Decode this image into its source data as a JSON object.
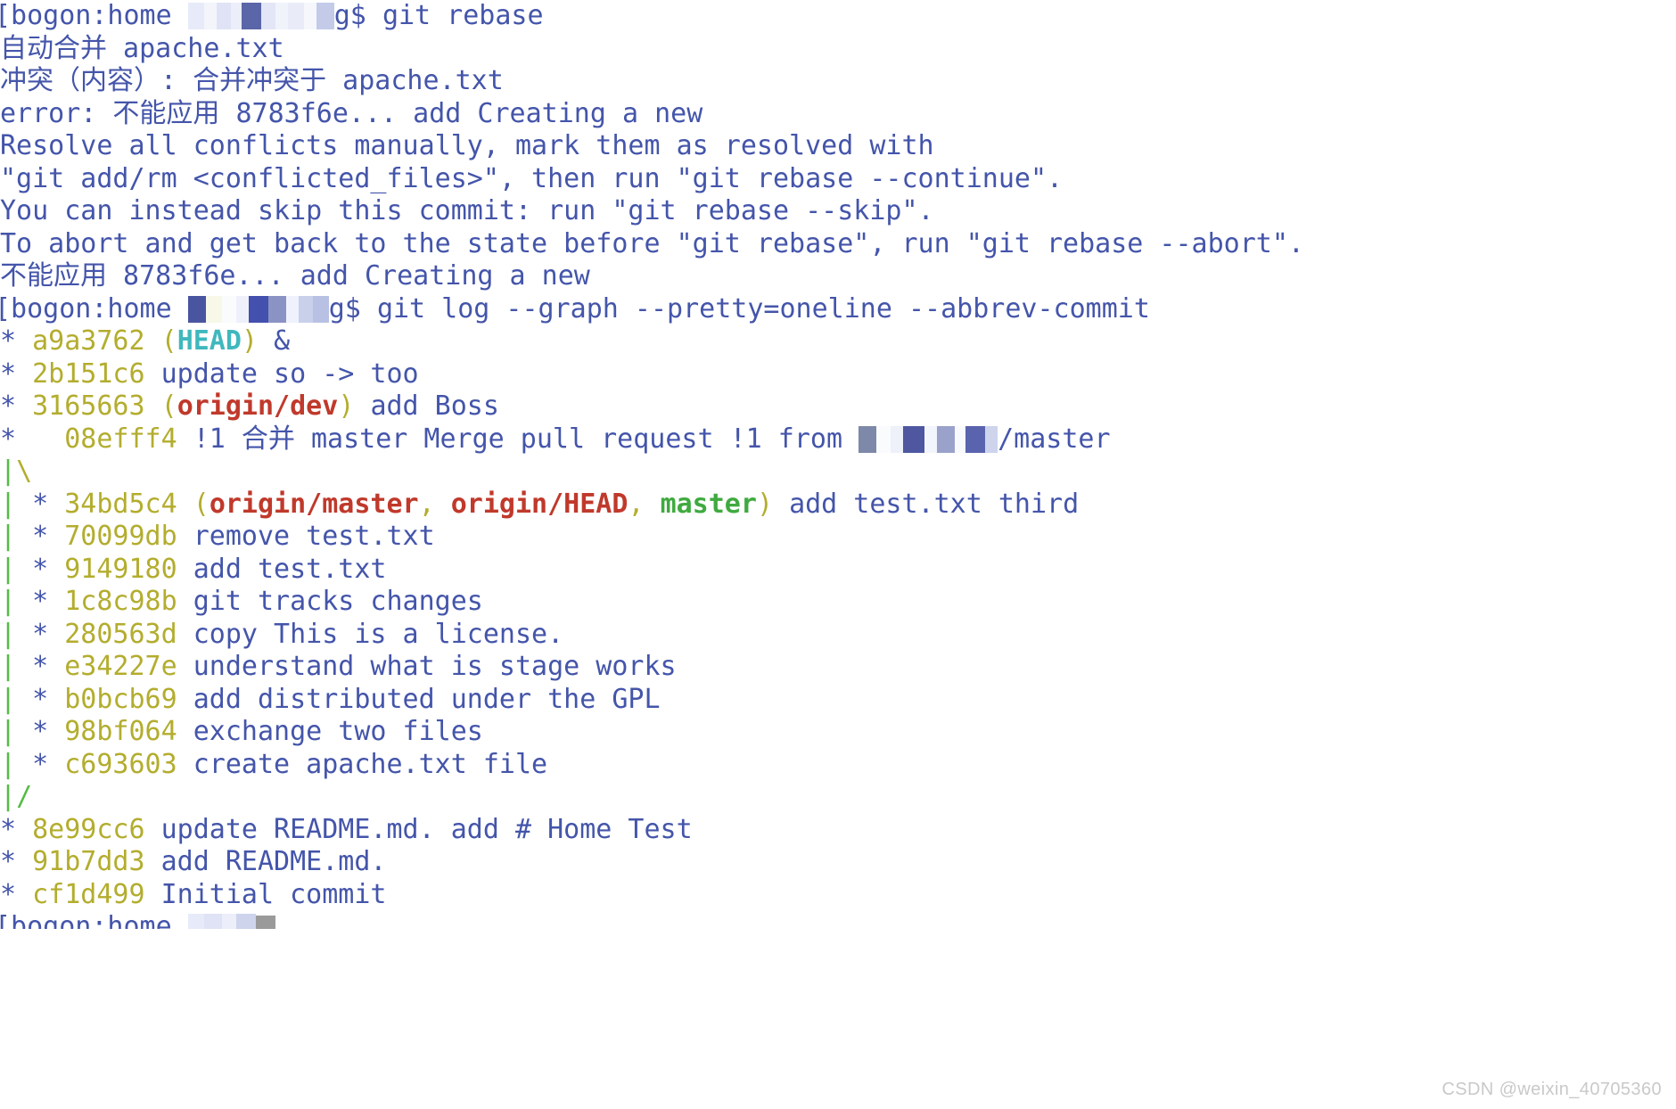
{
  "terminal": {
    "host_prompt": "[bogon:home ",
    "prompt_suffix": "g$ ",
    "colors": {
      "foreground": "#4455aa",
      "background": "#ffffff",
      "commit_hash": "#b3ad2e",
      "head_ref": "#3fb8bd",
      "remote_ref": "#c0392b",
      "local_ref": "#3faa3f",
      "graph_rail": "#55bb44",
      "graph_slash": "#b3ad2e",
      "cursor": "#9a9a9a",
      "watermark": "#c9c9c9"
    },
    "commands": {
      "rebase": "git rebase",
      "log": "git log --graph --pretty=oneline --abbrev-commit"
    },
    "rebase_output": [
      "自动合并 apache.txt",
      "冲突（内容）: 合并冲突于 apache.txt",
      "error: 不能应用 8783f6e... add Creating a new",
      "Resolve all conflicts manually, mark them as resolved with",
      "\"git add/rm <conflicted_files>\", then run \"git rebase --continue\".",
      "You can instead skip this commit: run \"git rebase --skip\".",
      "To abort and get back to the state before \"git rebase\", run \"git rebase --abort\".",
      "不能应用 8783f6e... add Creating a new"
    ],
    "log_entries": [
      {
        "rail": "",
        "star": "* ",
        "hash": "a9a3762",
        "refs_open": " (",
        "refs": [
          {
            "text": "HEAD",
            "kind": "head"
          }
        ],
        "refs_close": ") ",
        "subject": "&"
      },
      {
        "rail": "",
        "star": "* ",
        "hash": "2b151c6",
        "refs_open": " ",
        "refs": [],
        "refs_close": "",
        "subject": "update so -> too"
      },
      {
        "rail": "",
        "star": "* ",
        "hash": "3165663",
        "refs_open": " (",
        "refs": [
          {
            "text": "origin/dev",
            "kind": "remote"
          }
        ],
        "refs_close": ") ",
        "subject": "add Boss"
      },
      {
        "rail": "",
        "star": "*   ",
        "hash": "08efff4",
        "refs_open": " ",
        "refs": [],
        "refs_close": "",
        "subject": "!1 合并 master Merge pull request !1 from ",
        "redacted_tail": "/master"
      },
      {
        "rail": "graph-branch-open"
      },
      {
        "rail": "| ",
        "star": "* ",
        "hash": "34bd5c4",
        "refs_open": " (",
        "refs": [
          {
            "text": "origin/master",
            "kind": "remote"
          },
          {
            "text": "origin/HEAD",
            "kind": "remote"
          },
          {
            "text": "master",
            "kind": "local"
          }
        ],
        "refs_close": ") ",
        "subject": "add test.txt third"
      },
      {
        "rail": "| ",
        "star": "* ",
        "hash": "70099db",
        "refs_open": " ",
        "refs": [],
        "refs_close": "",
        "subject": "remove test.txt"
      },
      {
        "rail": "| ",
        "star": "* ",
        "hash": "9149180",
        "refs_open": " ",
        "refs": [],
        "refs_close": "",
        "subject": "add test.txt"
      },
      {
        "rail": "| ",
        "star": "* ",
        "hash": "1c8c98b",
        "refs_open": " ",
        "refs": [],
        "refs_close": "",
        "subject": "git tracks changes"
      },
      {
        "rail": "| ",
        "star": "* ",
        "hash": "280563d",
        "refs_open": " ",
        "refs": [],
        "refs_close": "",
        "subject": "copy This is a license."
      },
      {
        "rail": "| ",
        "star": "* ",
        "hash": "e34227e",
        "refs_open": " ",
        "refs": [],
        "refs_close": "",
        "subject": "understand what is stage works"
      },
      {
        "rail": "| ",
        "star": "* ",
        "hash": "b0bcb69",
        "refs_open": " ",
        "refs": [],
        "refs_close": "",
        "subject": "add distributed under the GPL"
      },
      {
        "rail": "| ",
        "star": "* ",
        "hash": "98bf064",
        "refs_open": " ",
        "refs": [],
        "refs_close": "",
        "subject": "exchange two files"
      },
      {
        "rail": "| ",
        "star": "* ",
        "hash": "c693603",
        "refs_open": " ",
        "refs": [],
        "refs_close": "",
        "subject": "create apache.txt file"
      },
      {
        "rail": "graph-branch-close"
      },
      {
        "rail": "",
        "star": "* ",
        "hash": "8e99cc6",
        "refs_open": " ",
        "refs": [],
        "refs_close": "",
        "subject": "update README.md. add # Home Test"
      },
      {
        "rail": "",
        "star": "* ",
        "hash": "91b7dd3",
        "refs_open": " ",
        "refs": [],
        "refs_close": "",
        "subject": "add README.md."
      },
      {
        "rail": "",
        "star": "* ",
        "hash": "cf1d499",
        "refs_open": " ",
        "refs": [],
        "refs_close": "",
        "subject": "Initial commit"
      }
    ],
    "graph_branch_open": "|\\",
    "graph_branch_close": "|/"
  },
  "watermark": {
    "text": "CSDN @weixin_40705360"
  }
}
